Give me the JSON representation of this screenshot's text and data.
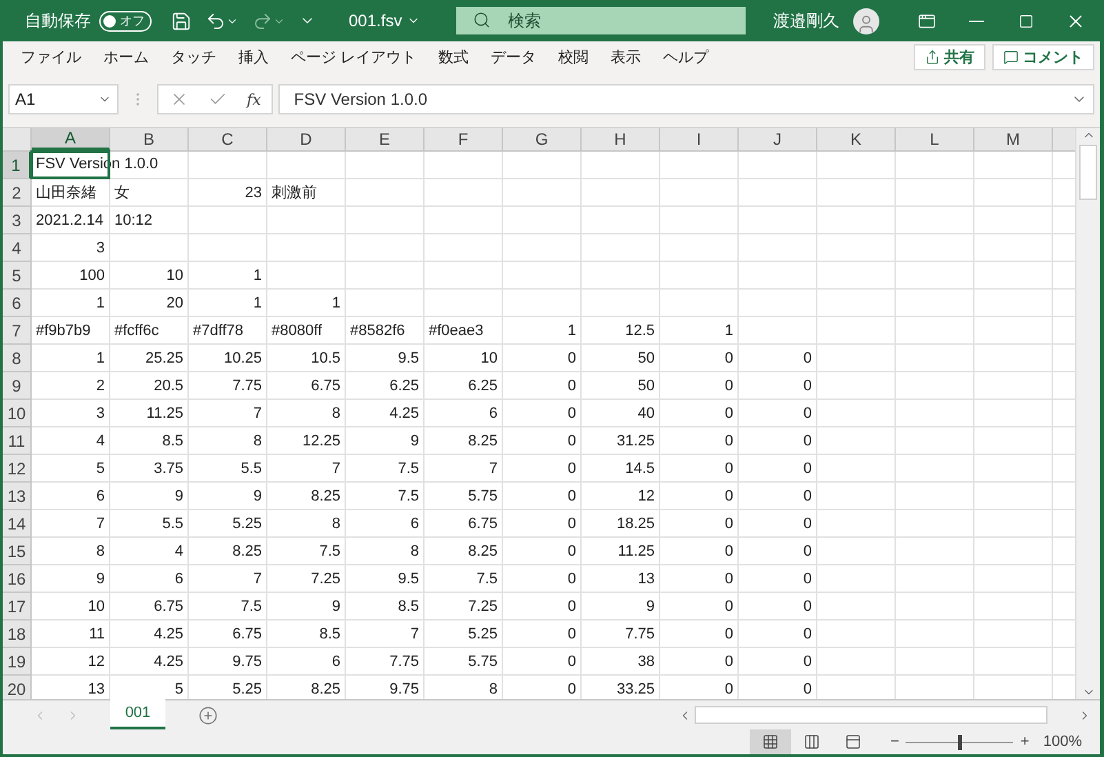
{
  "title_bar": {
    "autosave": {
      "label": "自動保存",
      "state": "オフ",
      "on": false
    },
    "undo_disabled": false,
    "redo_disabled": true,
    "filename": "001.fsv",
    "search": {
      "placeholder": "検索"
    },
    "user": "渡邉剛久"
  },
  "menu": [
    "ファイル",
    "ホーム",
    "タッチ",
    "挿入",
    "ページ レイアウト",
    "数式",
    "データ",
    "校閲",
    "表示",
    "ヘルプ"
  ],
  "menu_buttons": [
    {
      "label": "共有",
      "kind": "share"
    },
    {
      "label": "コメント",
      "kind": "comment"
    }
  ],
  "formula_bar": {
    "name_box": "A1",
    "function_label": "fx",
    "formula": "FSV Version 1.0.0"
  },
  "columns": [
    {
      "label": "A",
      "selected": true
    },
    {
      "label": "B",
      "selected": false
    },
    {
      "label": "C",
      "selected": false
    },
    {
      "label": "D",
      "selected": false
    },
    {
      "label": "E",
      "selected": false
    },
    {
      "label": "F",
      "selected": false
    },
    {
      "label": "G",
      "selected": false
    },
    {
      "label": "H",
      "selected": false
    },
    {
      "label": "I",
      "selected": false
    },
    {
      "label": "J",
      "selected": false
    },
    {
      "label": "K",
      "selected": false
    },
    {
      "label": "L",
      "selected": false
    },
    {
      "label": "M",
      "selected": false
    }
  ],
  "rows": [
    {
      "num": "1",
      "selected": true,
      "cells": [
        {
          "text": "FSV Version 1.0.0",
          "kind": "text"
        }
      ]
    },
    {
      "num": "2",
      "selected": false,
      "cells": [
        {
          "text": "山田奈緒",
          "kind": "text"
        },
        {
          "text": "女",
          "kind": "text"
        },
        "23",
        {
          "text": "刺激前",
          "kind": "text"
        }
      ]
    },
    {
      "num": "3",
      "selected": false,
      "cells": [
        {
          "text": "2021.2.14",
          "kind": "text"
        },
        {
          "text": "10:12",
          "kind": "text"
        }
      ]
    },
    {
      "num": "4",
      "selected": false,
      "cells": [
        "3"
      ]
    },
    {
      "num": "5",
      "selected": false,
      "cells": [
        "100",
        "10",
        "1"
      ]
    },
    {
      "num": "6",
      "selected": false,
      "cells": [
        "1",
        "20",
        "1",
        "1"
      ]
    },
    {
      "num": "7",
      "selected": false,
      "cells": [
        {
          "text": "#f9b7b9",
          "kind": "text"
        },
        {
          "text": "#fcff6c",
          "kind": "text"
        },
        {
          "text": "#7dff78",
          "kind": "text"
        },
        {
          "text": "#8080ff",
          "kind": "text"
        },
        {
          "text": "#8582f6",
          "kind": "text"
        },
        {
          "text": "#f0eae3",
          "kind": "text"
        },
        "1",
        "12.5",
        "1"
      ]
    },
    {
      "num": "8",
      "selected": false,
      "cells": [
        "1",
        "25.25",
        "10.25",
        "10.5",
        "9.5",
        "10",
        "0",
        "50",
        "0",
        "0"
      ]
    },
    {
      "num": "9",
      "selected": false,
      "cells": [
        "2",
        "20.5",
        "7.75",
        "6.75",
        "6.25",
        "6.25",
        "0",
        "50",
        "0",
        "0"
      ]
    },
    {
      "num": "10",
      "selected": false,
      "cells": [
        "3",
        "11.25",
        "7",
        "8",
        "4.25",
        "6",
        "0",
        "40",
        "0",
        "0"
      ]
    },
    {
      "num": "11",
      "selected": false,
      "cells": [
        "4",
        "8.5",
        "8",
        "12.25",
        "9",
        "8.25",
        "0",
        "31.25",
        "0",
        "0"
      ]
    },
    {
      "num": "12",
      "selected": false,
      "cells": [
        "5",
        "3.75",
        "5.5",
        "7",
        "7.5",
        "7",
        "0",
        "14.5",
        "0",
        "0"
      ]
    },
    {
      "num": "13",
      "selected": false,
      "cells": [
        "6",
        "9",
        "9",
        "8.25",
        "7.5",
        "5.75",
        "0",
        "12",
        "0",
        "0"
      ]
    },
    {
      "num": "14",
      "selected": false,
      "cells": [
        "7",
        "5.5",
        "5.25",
        "8",
        "6",
        "6.75",
        "0",
        "18.25",
        "0",
        "0"
      ]
    },
    {
      "num": "15",
      "selected": false,
      "cells": [
        "8",
        "4",
        "8.25",
        "7.5",
        "8",
        "8.25",
        "0",
        "11.25",
        "0",
        "0"
      ]
    },
    {
      "num": "16",
      "selected": false,
      "cells": [
        "9",
        "6",
        "7",
        "7.25",
        "9.5",
        "7.5",
        "0",
        "13",
        "0",
        "0"
      ]
    },
    {
      "num": "17",
      "selected": false,
      "cells": [
        "10",
        "6.75",
        "7.5",
        "9",
        "8.5",
        "7.25",
        "0",
        "9",
        "0",
        "0"
      ]
    },
    {
      "num": "18",
      "selected": false,
      "cells": [
        "11",
        "4.25",
        "6.75",
        "8.5",
        "7",
        "5.25",
        "0",
        "7.75",
        "0",
        "0"
      ]
    },
    {
      "num": "19",
      "selected": false,
      "cells": [
        "12",
        "4.25",
        "9.75",
        "6",
        "7.75",
        "5.75",
        "0",
        "38",
        "0",
        "0"
      ]
    },
    {
      "num": "20",
      "selected": false,
      "cells": [
        "13",
        "5",
        "5.25",
        "8.25",
        "9.75",
        "8",
        "0",
        "33.25",
        "0",
        "0"
      ]
    }
  ],
  "sheet_tabs": [
    {
      "label": "001",
      "selected": true
    }
  ],
  "status_bar": {
    "views": [
      {
        "kind": "normal",
        "selected": true
      },
      {
        "kind": "page_layout",
        "selected": false
      },
      {
        "kind": "page_break",
        "selected": false
      }
    ],
    "zoom_minus": "−",
    "zoom_plus": "+",
    "zoom": {
      "level": 0.5
    },
    "zoom_label": "100%"
  }
}
